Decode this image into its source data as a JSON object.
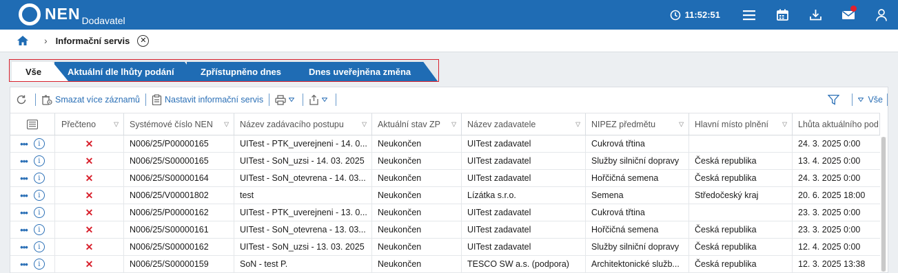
{
  "app": {
    "logo": "NEN",
    "subtitle": "Dodavatel",
    "time": "11:52:51"
  },
  "header_icons": [
    "clock-icon",
    "menu-icon",
    "calendar-icon",
    "download-icon",
    "mail-icon",
    "user-icon"
  ],
  "breadcrumb": {
    "title": "Informační servis"
  },
  "tabs": [
    {
      "label": "Vše",
      "active": true
    },
    {
      "label": "Aktuální dle lhůty podání"
    },
    {
      "label": "Zpřístupněno dnes"
    },
    {
      "label": "Dnes uveřejněna změna"
    }
  ],
  "toolbar": {
    "delete_label": "Smazat více záznamů",
    "settings_label": "Nastavit informační servis",
    "filter_all_label": "Vše"
  },
  "columns": [
    "Přečteno",
    "Systémové číslo NEN",
    "Název zadávacího postupu",
    "Aktuální stav ZP",
    "Název zadavatele",
    "NIPEZ předmětu",
    "Hlavní místo plnění",
    "Lhůta aktuálního pod"
  ],
  "rows": [
    {
      "cislo": "N006/25/P00000165",
      "nazev": "UITest - PTK_uverejneni - 14. 0...",
      "stav": "Neukončen",
      "zadavatel": "UITest zadavatel",
      "nipez": "Cukrová třtina",
      "misto": "",
      "lhuta": "24. 3. 2025 0:00"
    },
    {
      "cislo": "N006/25/S00000165",
      "nazev": "UITest - SoN_uzsi - 14. 03. 2025",
      "stav": "Neukončen",
      "zadavatel": "UITest zadavatel",
      "nipez": "Služby silniční dopravy",
      "misto": "Česká republika",
      "lhuta": "13. 4. 2025 0:00"
    },
    {
      "cislo": "N006/25/S00000164",
      "nazev": "UITest - SoN_otevrena - 14. 03...",
      "stav": "Neukončen",
      "zadavatel": "UITest zadavatel",
      "nipez": "Hořčičná semena",
      "misto": "Česká republika",
      "lhuta": "24. 3. 2025 0:00"
    },
    {
      "cislo": "N006/25/V00001802",
      "nazev": "test",
      "stav": "Neukončen",
      "zadavatel": "Lízátka s.r.o.",
      "nipez": "Semena",
      "misto": "Středočeský kraj",
      "lhuta": "20. 6. 2025 18:00"
    },
    {
      "cislo": "N006/25/P00000162",
      "nazev": "UITest - PTK_uverejneni - 13. 0...",
      "stav": "Neukončen",
      "zadavatel": "UITest zadavatel",
      "nipez": "Cukrová třtina",
      "misto": "",
      "lhuta": "23. 3. 2025 0:00"
    },
    {
      "cislo": "N006/25/S00000161",
      "nazev": "UITest - SoN_otevrena - 13. 03...",
      "stav": "Neukončen",
      "zadavatel": "UITest zadavatel",
      "nipez": "Hořčičná semena",
      "misto": "Česká republika",
      "lhuta": "23. 3. 2025 0:00"
    },
    {
      "cislo": "N006/25/S00000162",
      "nazev": "UITest - SoN_uzsi - 13. 03. 2025",
      "stav": "Neukončen",
      "zadavatel": "UITest zadavatel",
      "nipez": "Služby silniční dopravy",
      "misto": "Česká republika",
      "lhuta": "12. 4. 2025 0:00"
    },
    {
      "cislo": "N006/25/S00000159",
      "nazev": "SoN - test P.",
      "stav": "Neukončen",
      "zadavatel": "TESCO SW a.s. (podpora)",
      "nipez": "Architektonické služb...",
      "misto": "Česká republika",
      "lhuta": "12. 3. 2025 13:38"
    }
  ],
  "colors": {
    "brand_blue": "#1f6cb4",
    "unread_red": "#d8202c"
  }
}
